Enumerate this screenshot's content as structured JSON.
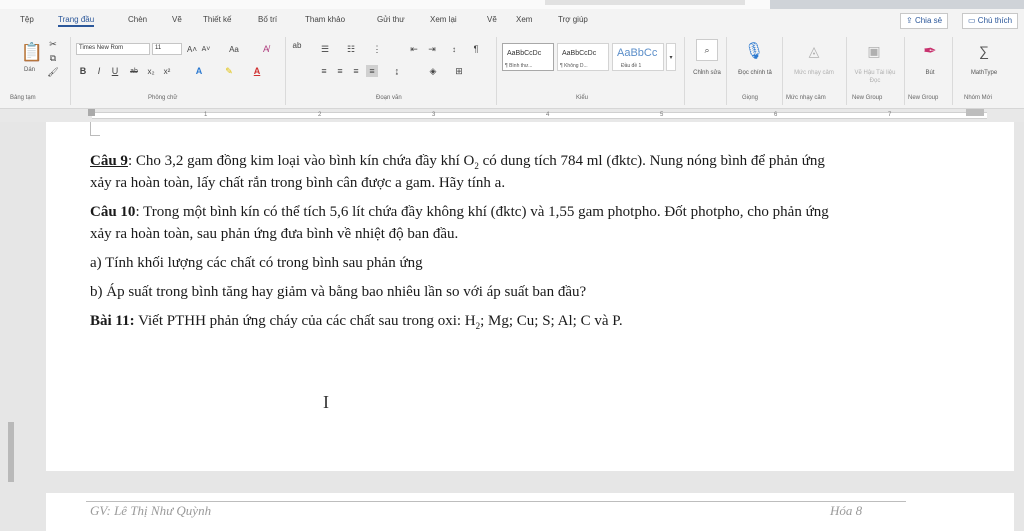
{
  "tabs": [
    "Tệp",
    "Trang đầu",
    "Chèn",
    "Vẽ",
    "Thiết kế",
    "Bố trí",
    "Tham khảo",
    "Gửi thư",
    "Xem lại",
    "Vẽ",
    "Xem",
    "Trợ giúp"
  ],
  "share_label": "Chia sẻ",
  "comment_label": "Chú thích",
  "ribbon": {
    "paste_label": "Dán",
    "font_name": "Times New Rom",
    "font_size": "11",
    "style_cards": [
      {
        "sample": "AaBbCcDc",
        "name": "¶ Bình thư..."
      },
      {
        "sample": "AaBbCcDc",
        "name": "¶ Không D..."
      },
      {
        "sample": "AaBbCc",
        "name": "Đầu đề 1"
      }
    ],
    "edit_label": "Chỉnh sửa",
    "dictate_label": "Đọc chính tả",
    "sensitivity_label": "Mức nhạy cảm",
    "adobe_label": "Vẽ Hậu Tài liệu Đọc",
    "pen_label": "Bút",
    "mathtype_label": "MathType",
    "groups": [
      "Bảng tạm",
      "Phông chữ",
      "Đoạn văn",
      "Kiểu",
      "Giọng",
      "Mức nhạy cảm",
      "New Group",
      "New Group",
      "Nhóm Mới"
    ]
  },
  "ruler_numbers": [
    "1",
    "2",
    "3",
    "4",
    "5",
    "6",
    "7"
  ],
  "doc": {
    "p1_label": "Câu 9",
    "p1_line1": ": Cho 3,2 gam đồng kim loại vào bình kín chứa đầy khí O",
    "p1_sub": "2",
    "p1_line1b": " có dung tích 784 ml (đktc). Nung nóng bình để phản ứng",
    "p1_line2": "xảy ra hoàn toàn, lấy chất rắn trong bình cân được a gam. Hãy tính a.",
    "p2_label": "Câu 10",
    "p2_line1": ": Trong một bình kín có thể tích 5,6 lít chứa đầy không khí (đktc) và 1,55 gam photpho. Đốt photpho, cho phản ứng",
    "p2_line2": "xảy ra hoàn toàn, sau phản ứng đưa bình về nhiệt độ ban đầu.",
    "p3": "a) Tính khối lượng các chất có trong bình sau phản ứng",
    "p4": "b) Áp suất trong bình tăng hay giảm và bằng bao nhiêu lần so với áp suất ban đầu?",
    "p5_label": "Bài 11:",
    "p5_a": " Viết PTHH phản ứng cháy của các chất sau trong oxi: H",
    "p5_sub": "2",
    "p5_b": "; Mg; Cu; S; Al; C và P.",
    "cursor_glyph": "I"
  },
  "footer": {
    "author": "GV: Lê Thị Như Quỳnh",
    "subject": "Hóa 8"
  }
}
